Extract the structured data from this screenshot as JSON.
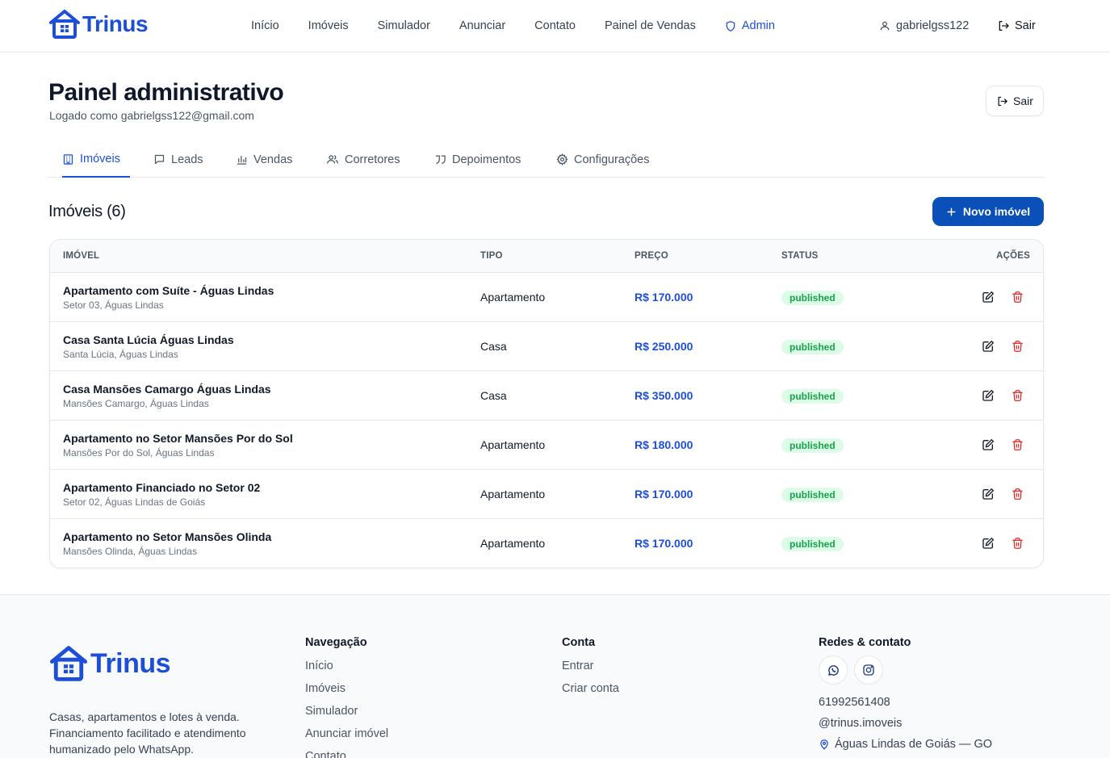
{
  "brand": {
    "name": "Trinus",
    "color": "#1d4ed8"
  },
  "nav": {
    "links": [
      "Início",
      "Imóveis",
      "Simulador",
      "Anunciar",
      "Contato",
      "Painel de Vendas"
    ],
    "admin": "Admin",
    "user": "gabrielgss122",
    "logout": "Sair"
  },
  "header": {
    "title": "Painel administrativo",
    "subtitle": "Logado como gabrielgss122@gmail.com",
    "logout": "Sair"
  },
  "tabs": [
    {
      "label": "Imóveis",
      "icon": "building-icon",
      "active": true
    },
    {
      "label": "Leads",
      "icon": "message-icon",
      "active": false
    },
    {
      "label": "Vendas",
      "icon": "bar-chart-icon",
      "active": false
    },
    {
      "label": "Corretores",
      "icon": "users-icon",
      "active": false
    },
    {
      "label": "Depoimentos",
      "icon": "quote-icon",
      "active": false
    },
    {
      "label": "Configurações",
      "icon": "gear-icon",
      "active": false
    }
  ],
  "section": {
    "title": "Imóveis (6)",
    "new_button": "Novo imóvel"
  },
  "table": {
    "headers": {
      "property": "IMÓVEL",
      "type": "TIPO",
      "price": "PREÇO",
      "status": "STATUS",
      "actions": "AÇÕES"
    },
    "rows": [
      {
        "name": "Apartamento com Suíte - Águas Lindas",
        "location": "Setor 03, Águas Lindas",
        "type": "Apartamento",
        "price": "R$ 170.000",
        "status": "published"
      },
      {
        "name": "Casa Santa Lúcia Águas Lindas",
        "location": "Santa Lúcia, Águas Lindas",
        "type": "Casa",
        "price": "R$ 250.000",
        "status": "published"
      },
      {
        "name": "Casa Mansões Camargo Águas Lindas",
        "location": "Mansões Camargo, Águas Lindas",
        "type": "Casa",
        "price": "R$ 350.000",
        "status": "published"
      },
      {
        "name": "Apartamento no Setor Mansões Por do Sol",
        "location": "Mansões Por do Sol, Águas Lindas",
        "type": "Apartamento",
        "price": "R$ 180.000",
        "status": "published"
      },
      {
        "name": "Apartamento Financiado no Setor 02",
        "location": "Setor 02, Águas Lindas de Goiás",
        "type": "Apartamento",
        "price": "R$ 170.000",
        "status": "published"
      },
      {
        "name": "Apartamento no Setor Mansões Olinda",
        "location": "Mansões Olinda, Águas Lindas",
        "type": "Apartamento",
        "price": "R$ 170.000",
        "status": "published"
      }
    ]
  },
  "footer": {
    "description": "Casas, apartamentos e lotes à venda. Financiamento facilitado e atendimento humanizado pelo WhatsApp.",
    "navigation": {
      "title": "Navegação",
      "links": [
        "Início",
        "Imóveis",
        "Simulador",
        "Anunciar imóvel",
        "Contato"
      ]
    },
    "account": {
      "title": "Conta",
      "links": [
        "Entrar",
        "Criar conta"
      ]
    },
    "contact": {
      "title": "Redes & contato",
      "phone": "61992561408",
      "instagram": "@trinus.imoveis",
      "location": "Águas Lindas de Goiás — GO"
    }
  }
}
